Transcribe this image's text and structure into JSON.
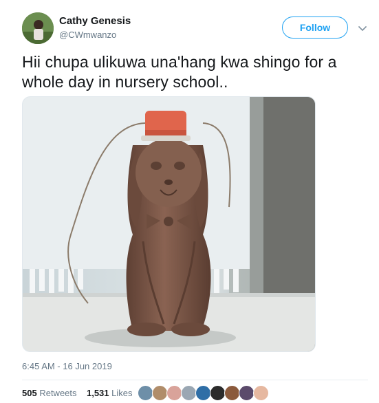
{
  "user": {
    "name": "Cathy Genesis",
    "handle": "@CWmwanzo"
  },
  "follow_label": "Follow",
  "tweet_text": "Hii chupa ulikuwa una'hang kwa shingo for a whole day in nursery school..",
  "timestamp": "6:45 AM - 16 Jun 2019",
  "stats": {
    "retweets_count": "505",
    "retweets_label": "Retweets",
    "likes_count": "1,531",
    "likes_label": "Likes"
  },
  "colors": {
    "accent": "#1da1f2",
    "bottle": "#7a5444",
    "cap": "#e0654c"
  }
}
